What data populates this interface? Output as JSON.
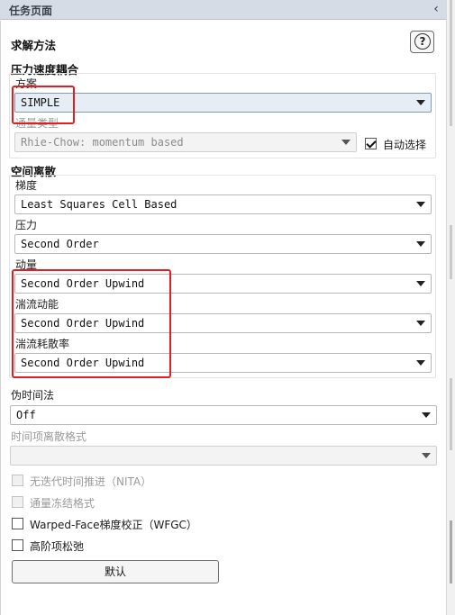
{
  "panel": {
    "title": "任务页面",
    "collapse_icon": "‹"
  },
  "solution_methods": {
    "heading": "求解方法"
  },
  "pressure_velocity_coupling": {
    "heading": "压力速度耦合",
    "scheme_label": "方案",
    "scheme_value": "SIMPLE",
    "flux_type_label": "通量类型",
    "flux_type_value": "Rhie-Chow: momentum based",
    "auto_select_label": "自动选择",
    "auto_select_checked": true
  },
  "spatial_discretization": {
    "heading": "空间离散",
    "items": [
      {
        "label": "梯度",
        "value": "Least Squares Cell Based"
      },
      {
        "label": "压力",
        "value": "Second Order"
      },
      {
        "label": "动量",
        "value": "Second Order Upwind"
      },
      {
        "label": "湍流动能",
        "value": "Second Order Upwind"
      },
      {
        "label": "湍流耗散率",
        "value": "Second Order Upwind"
      }
    ]
  },
  "pseudo_time": {
    "label": "伪时间法",
    "value": "Off"
  },
  "transient_formulation": {
    "label": "时间项离散格式",
    "value": ""
  },
  "options": [
    {
      "label": "无迭代时间推进（NITA）",
      "checked": false,
      "disabled": true
    },
    {
      "label": "通量冻结格式",
      "checked": false,
      "disabled": true
    },
    {
      "label": "Warped-Face梯度校正（WFGC）",
      "checked": false,
      "disabled": false
    },
    {
      "label": "高阶项松弛",
      "checked": false,
      "disabled": false
    }
  ],
  "default_button": {
    "label": "默认"
  },
  "icons": {
    "help": "?"
  },
  "colors": {
    "highlight": "#e02020",
    "titlebar": "#d6dce6"
  }
}
